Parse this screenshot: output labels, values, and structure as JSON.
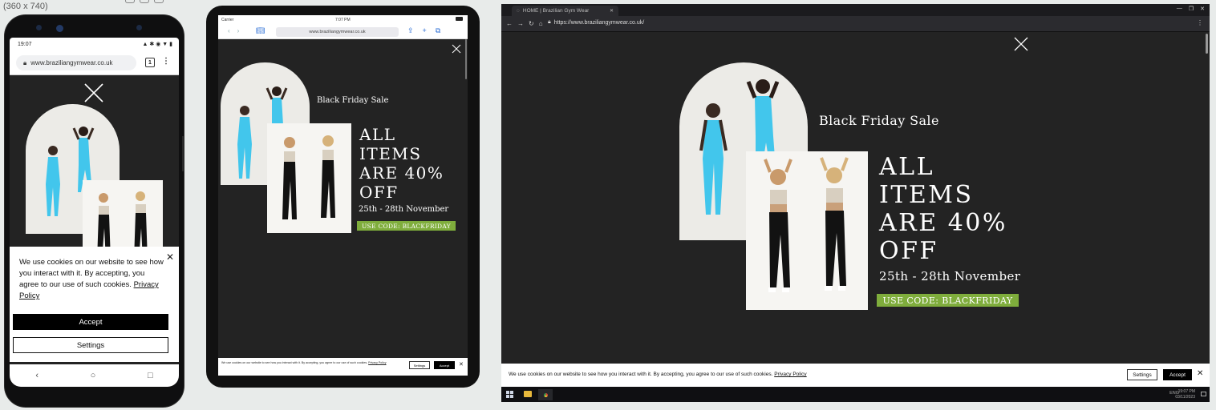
{
  "canvas": {
    "label": "(360 x 740)"
  },
  "site": {
    "url_short": "www.braziliangymwear.co.uk",
    "url_full": "https://www.braziliangymwear.co.uk/",
    "tab_title": "HOME | Brazilian Gym Wear"
  },
  "promo": {
    "sale_label": "Black Friday Sale",
    "headline_lines": [
      "ALL",
      "ITEMS",
      "ARE 40%",
      "OFF"
    ],
    "dates": "25th - 28th November",
    "code": "USE CODE: BLACKFRIDAY"
  },
  "cookie": {
    "text": "We use cookies on our website to see how you interact with it. By accepting, you agree to our use of such cookies.",
    "policy_link": "Privacy Policy",
    "accept_label": "Accept",
    "settings_label": "Settings"
  },
  "phone": {
    "time": "19:07",
    "tab_count": "1"
  },
  "tablet": {
    "carrier": "Carrier",
    "time": "7:07 PM"
  },
  "desktop": {
    "tray_lang": "ENG",
    "clock_time": "19:07 PM",
    "clock_date": "03/11/2023"
  },
  "colors": {
    "page_bg": "#232323",
    "code_bg": "#7fad3c",
    "product_blue": "#42c6ec"
  },
  "icons": {
    "close": "close-icon",
    "lock": "lock-icon",
    "menu": "kebab-menu-icon",
    "back": "back-icon",
    "home": "home-icon",
    "recents": "recents-icon"
  }
}
